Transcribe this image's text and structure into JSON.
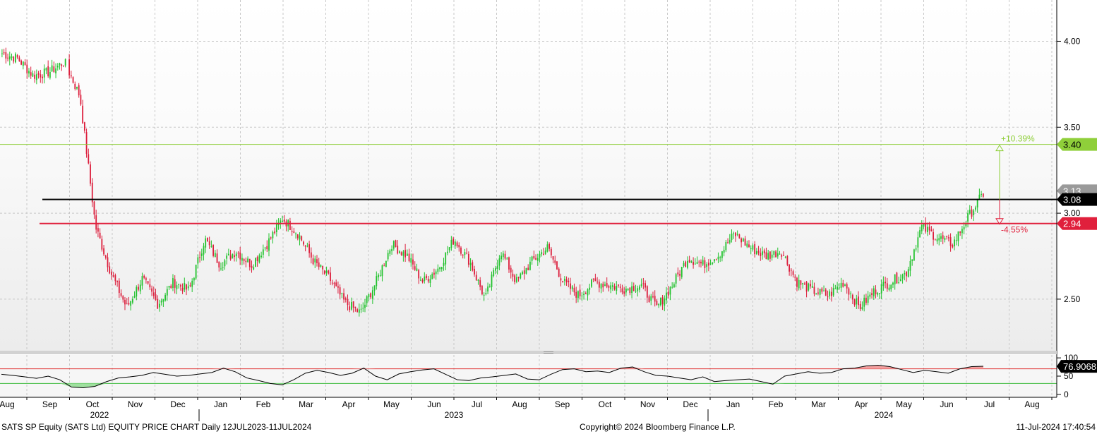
{
  "footer": {
    "left": "SATS SP Equity (SATS Ltd) EQUITY PRICE CHART  Daily 12JUL2023-11JUL2024",
    "center": "Copyright© 2024 Bloomberg Finance L.P.",
    "right": "11-Jul-2024 17:40:54"
  },
  "chart_data": [
    {
      "type": "candlestick",
      "ylim": [
        2.2,
        4.24
      ],
      "yticks": [
        "2.50",
        "3.00",
        "3.50",
        "4.00"
      ],
      "month_labels": [
        "Aug",
        "Sep",
        "Oct",
        "Nov",
        "Dec",
        "Jan",
        "Feb",
        "Mar",
        "Apr",
        "May",
        "Jun",
        "Jul",
        "Aug",
        "Sep",
        "Oct",
        "Nov",
        "Dec",
        "Jan",
        "Feb",
        "Mar",
        "Apr",
        "May",
        "Jun",
        "Jul",
        "Aug"
      ],
      "year_labels": [
        "2022",
        "2023",
        "2024"
      ],
      "close_anchors": [
        {
          "x": "Aug",
          "y": 3.93
        },
        {
          "x": "Aug",
          "y": 3.9
        },
        {
          "x": "Aug",
          "y": 3.8
        },
        {
          "x": "Sep",
          "y": 3.82
        },
        {
          "x": "Sep",
          "y": 3.88
        },
        {
          "x": "Sep",
          "y": 3.68
        },
        {
          "x": "Sep",
          "y": 2.92
        },
        {
          "x": "Oct",
          "y": 2.65
        },
        {
          "x": "Oct",
          "y": 2.45
        },
        {
          "x": "Oct",
          "y": 2.62
        },
        {
          "x": "Nov",
          "y": 2.47
        },
        {
          "x": "Nov",
          "y": 2.6
        },
        {
          "x": "Nov",
          "y": 2.55
        },
        {
          "x": "Dec",
          "y": 2.85
        },
        {
          "x": "Dec",
          "y": 2.7
        },
        {
          "x": "Dec",
          "y": 2.78
        },
        {
          "x": "Jan",
          "y": 2.7
        },
        {
          "x": "Jan",
          "y": 2.82
        },
        {
          "x": "Jan",
          "y": 2.97
        },
        {
          "x": "Feb",
          "y": 2.88
        },
        {
          "x": "Feb",
          "y": 2.72
        },
        {
          "x": "Feb",
          "y": 2.62
        },
        {
          "x": "Mar",
          "y": 2.48
        },
        {
          "x": "Mar",
          "y": 2.42
        },
        {
          "x": "Mar",
          "y": 2.6
        },
        {
          "x": "Apr",
          "y": 2.82
        },
        {
          "x": "Apr",
          "y": 2.75
        },
        {
          "x": "Apr",
          "y": 2.6
        },
        {
          "x": "May",
          "y": 2.68
        },
        {
          "x": "May",
          "y": 2.85
        },
        {
          "x": "May",
          "y": 2.72
        },
        {
          "x": "Jun",
          "y": 2.5
        },
        {
          "x": "Jun",
          "y": 2.78
        },
        {
          "x": "Jun",
          "y": 2.6
        },
        {
          "x": "Jul",
          "y": 2.72
        },
        {
          "x": "Jul",
          "y": 2.8
        },
        {
          "x": "Aug",
          "y": 2.6
        },
        {
          "x": "Aug",
          "y": 2.52
        },
        {
          "x": "Aug",
          "y": 2.6
        },
        {
          "x": "Sep",
          "y": 2.58
        },
        {
          "x": "Sep",
          "y": 2.56
        },
        {
          "x": "Oct",
          "y": 2.58
        },
        {
          "x": "Oct",
          "y": 2.45
        },
        {
          "x": "Nov",
          "y": 2.58
        },
        {
          "x": "Nov",
          "y": 2.74
        },
        {
          "x": "Dec",
          "y": 2.7
        },
        {
          "x": "Dec",
          "y": 2.76
        },
        {
          "x": "Jan",
          "y": 2.88
        },
        {
          "x": "Jan",
          "y": 2.8
        },
        {
          "x": "Jan",
          "y": 2.75
        },
        {
          "x": "Feb",
          "y": 2.78
        },
        {
          "x": "Feb",
          "y": 2.6
        },
        {
          "x": "Mar",
          "y": 2.55
        },
        {
          "x": "Mar",
          "y": 2.52
        },
        {
          "x": "Apr",
          "y": 2.6
        },
        {
          "x": "Apr",
          "y": 2.45
        },
        {
          "x": "May",
          "y": 2.55
        },
        {
          "x": "May",
          "y": 2.6
        },
        {
          "x": "May",
          "y": 2.65
        },
        {
          "x": "Jun",
          "y": 2.92
        },
        {
          "x": "Jun",
          "y": 2.86
        },
        {
          "x": "Jun",
          "y": 2.82
        },
        {
          "x": "Jul",
          "y": 2.98
        },
        {
          "x": "Jul",
          "y": 3.12
        }
      ],
      "last_price": "3.13",
      "resistance_level": "3.08",
      "support_level": "2.94",
      "target_level": "3.40",
      "upside_label": "+10.39%",
      "downside_label": "-4.55%",
      "colors": {
        "up": "#22c22e",
        "down": "#dc1e3c",
        "target": "#8fcf3a",
        "resistance": "#000000",
        "support": "#e0203c",
        "badge_last": "#9a9a9a"
      }
    },
    {
      "type": "line",
      "ylim": [
        -8,
        108
      ],
      "yticks": [
        "0",
        "50",
        "100"
      ],
      "last_value": "76.9068",
      "overbought": 70,
      "oversold": 30,
      "values": [
        55,
        52,
        48,
        44,
        50,
        40,
        20,
        18,
        22,
        35,
        45,
        48,
        52,
        60,
        55,
        50,
        52,
        56,
        60,
        72,
        62,
        45,
        38,
        30,
        26,
        40,
        58,
        66,
        60,
        52,
        58,
        72,
        50,
        40,
        56,
        62,
        67,
        70,
        55,
        40,
        38,
        45,
        48,
        52,
        56,
        42,
        40,
        55,
        68,
        70,
        62,
        64,
        60,
        72,
        75,
        62,
        52,
        50,
        45,
        40,
        48,
        35,
        38,
        40,
        42,
        35,
        28,
        50,
        56,
        62,
        58,
        60,
        70,
        72,
        78,
        80,
        76,
        68,
        60,
        66,
        62,
        58,
        70,
        76,
        77
      ]
    }
  ]
}
